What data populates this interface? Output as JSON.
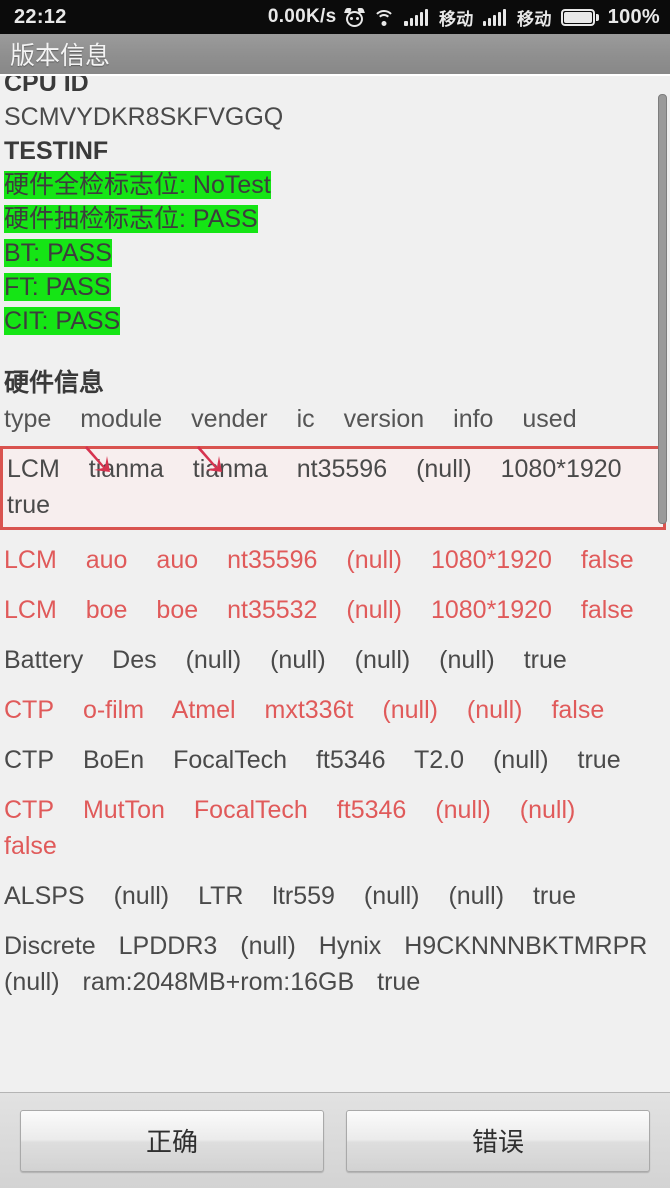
{
  "statusbar": {
    "clock": "22:12",
    "netspeed": "0.00K/s",
    "alarm_icon": "alarm-clock-icon",
    "wifi_icon": "wifi-icon",
    "carrier_1": "移动",
    "carrier_2": "移动",
    "battery_percent": "100%"
  },
  "titlebar": {
    "title": "版本信息"
  },
  "content": {
    "cpu_id_label": "CPU ID",
    "cpu_id_value": "SCMVYDKR8SKFVGGQ",
    "testinf_label": "TESTINF",
    "test_flags": [
      {
        "text": "硬件全检标志位: NoTest"
      },
      {
        "text": "硬件抽检标志位: PASS"
      },
      {
        "text": "BT: PASS"
      },
      {
        "text": "FT: PASS"
      },
      {
        "text": "CIT: PASS"
      }
    ],
    "hardware_section_title": "硬件信息",
    "table_headers": [
      "type",
      "module",
      "vender",
      "ic",
      "version",
      "info",
      "used"
    ],
    "highlighted_row": {
      "cells": [
        "LCM",
        "tianma",
        "tianma",
        "nt35596",
        "(null)",
        "1080*1920",
        "true"
      ],
      "annotation_arrows": 2
    },
    "rows": [
      {
        "cells": [
          "LCM",
          "auo",
          "auo",
          "nt35596",
          "(null)",
          "1080*1920",
          "false"
        ],
        "color": "red"
      },
      {
        "cells": [
          "LCM",
          "boe",
          "boe",
          "nt35532",
          "(null)",
          "1080*1920",
          "false"
        ],
        "color": "red"
      },
      {
        "cells": [
          "Battery",
          "Des",
          "(null)",
          "(null)",
          "(null)",
          "(null)",
          "true"
        ],
        "color": "dark"
      },
      {
        "cells": [
          "CTP",
          "o-film",
          "Atmel",
          "mxt336t",
          "(null)",
          "(null)",
          "false"
        ],
        "color": "red"
      },
      {
        "cells": [
          "CTP",
          "BoEn",
          "FocalTech",
          "ft5346",
          "T2.0",
          "(null)",
          "true"
        ],
        "color": "dark"
      },
      {
        "cells": [
          "CTP",
          "MutTon",
          "FocalTech",
          "ft5346",
          "(null)",
          "(null)",
          "false"
        ],
        "color": "red"
      },
      {
        "cells": [
          "ALSPS",
          "(null)",
          "LTR",
          "ltr559",
          "(null)",
          "(null)",
          "true"
        ],
        "color": "dark"
      },
      {
        "cells": [
          "Discrete",
          "LPDDR3",
          "(null)",
          "Hynix",
          "H9CKNNNBKTMRPR",
          "(null)",
          "ram:2048MB+rom:16GB",
          "true"
        ],
        "color": "dark"
      }
    ]
  },
  "buttons": {
    "correct_label": "正确",
    "error_label": "错误"
  },
  "colors": {
    "highlight_green": "#15e515",
    "row_red": "#e05a5a",
    "box_red": "#d9534f",
    "arrow_red": "#d6334f",
    "titlebar_gray": "#909090",
    "statusbar_black": "#0b0b0b"
  }
}
